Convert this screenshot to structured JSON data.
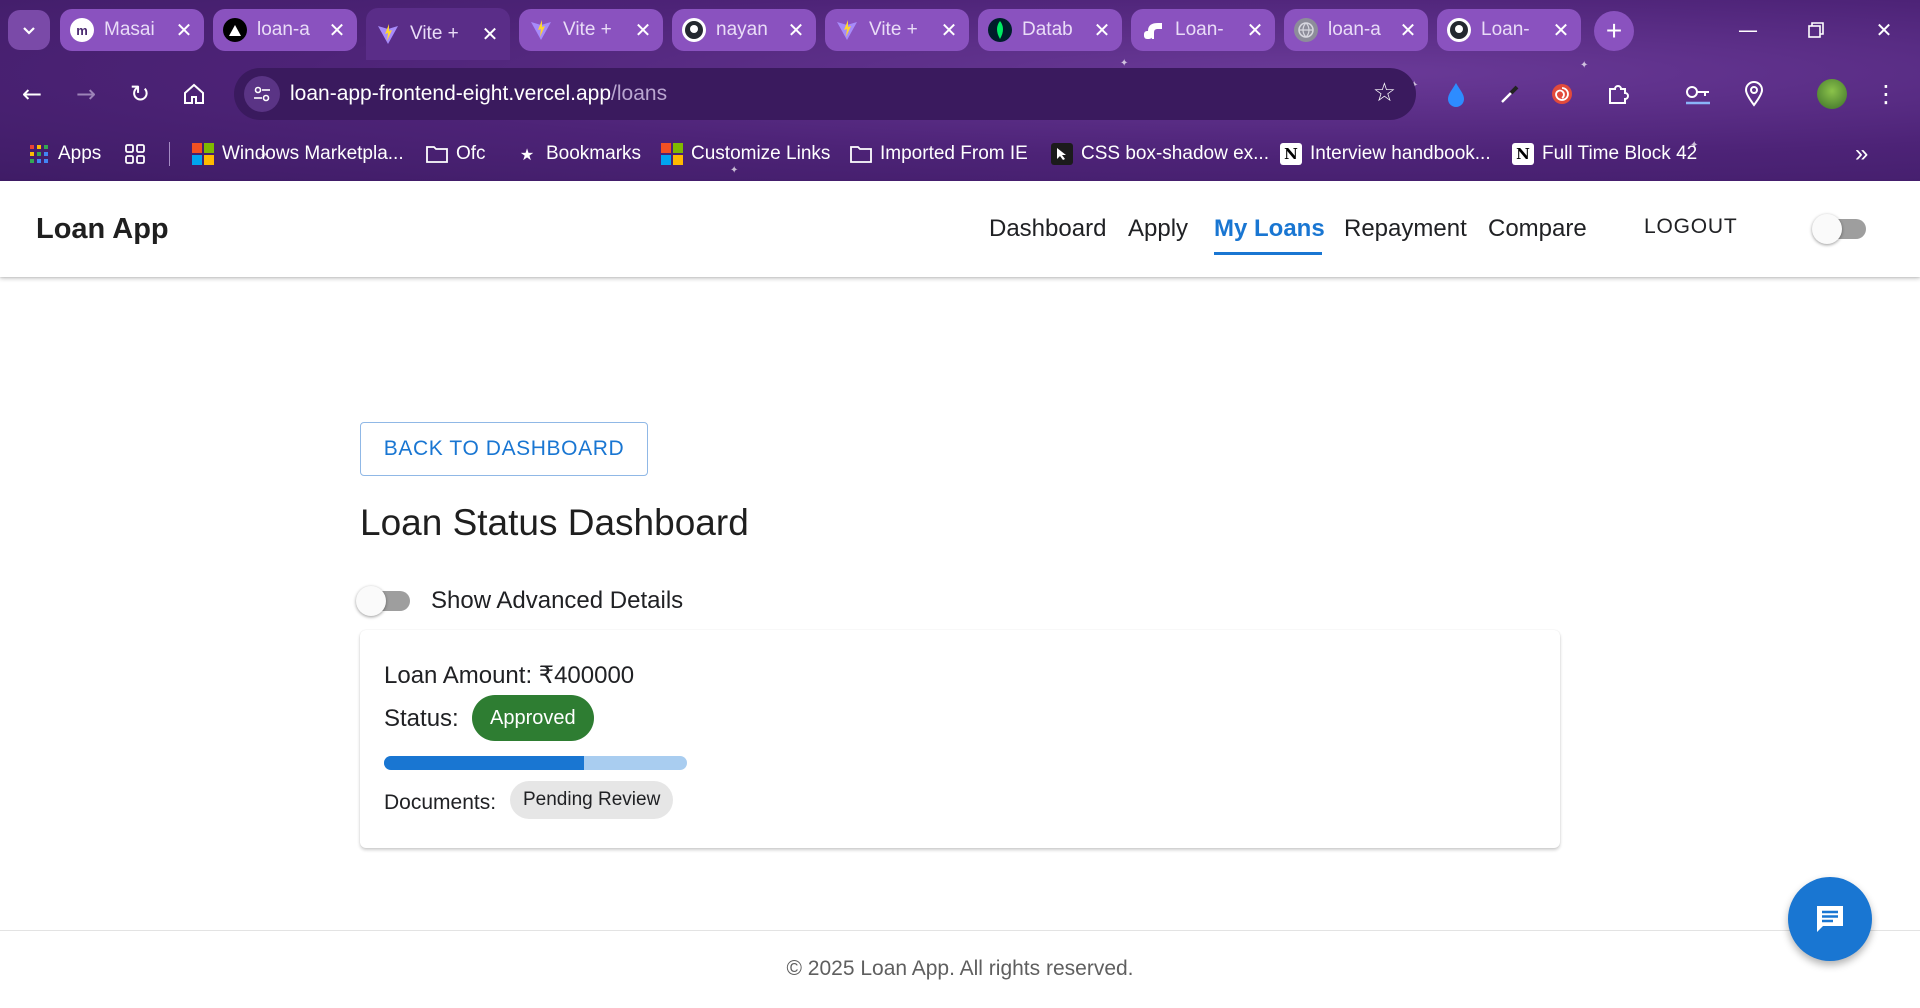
{
  "browser": {
    "tabs": [
      {
        "title": "Masai",
        "icon": "masai-logo-icon",
        "active": false
      },
      {
        "title": "loan-a",
        "icon": "vercel-logo-icon",
        "active": false
      },
      {
        "title": "Vite +",
        "icon": "vite-logo-icon",
        "active": true
      },
      {
        "title": "Vite +",
        "icon": "vite-logo-icon",
        "active": false
      },
      {
        "title": "nayan",
        "icon": "github-logo-icon",
        "active": false
      },
      {
        "title": "Vite +",
        "icon": "vite-logo-icon",
        "active": false
      },
      {
        "title": "Datab",
        "icon": "mongodb-leaf-icon",
        "active": false
      },
      {
        "title": "Loan-",
        "icon": "render-logo-icon",
        "active": false
      },
      {
        "title": "loan-a",
        "icon": "globe-icon",
        "active": false
      },
      {
        "title": "Loan-",
        "icon": "github-logo-icon",
        "active": false
      }
    ],
    "url_host": "loan-app-frontend-eight.vercel.app",
    "url_path": "/loans",
    "bookmarks": [
      {
        "label": "Apps",
        "icon": "apps-grid-icon"
      },
      {
        "label": "",
        "icon": "tab-groups-icon"
      },
      {
        "label": "Windows Marketpla...",
        "icon": "microsoft-logo-icon"
      },
      {
        "label": "Ofc",
        "icon": "folder-icon"
      },
      {
        "label": "Bookmarks",
        "icon": "star-icon"
      },
      {
        "label": "Customize Links",
        "icon": "microsoft-logo-icon"
      },
      {
        "label": "Imported From IE",
        "icon": "folder-icon"
      },
      {
        "label": "CSS box-shadow ex...",
        "icon": "cursor-icon"
      },
      {
        "label": "Interview handbook...",
        "icon": "notion-logo-icon"
      },
      {
        "label": "Full Time Block 42",
        "icon": "notion-logo-icon"
      }
    ]
  },
  "app": {
    "brand": "Loan App",
    "nav": [
      {
        "label": "Dashboard",
        "active": false
      },
      {
        "label": "Apply",
        "active": false
      },
      {
        "label": "My Loans",
        "active": true
      },
      {
        "label": "Repayment",
        "active": false
      },
      {
        "label": "Compare",
        "active": false
      }
    ],
    "logout_label": "LOGOUT",
    "theme_toggle_on": false
  },
  "main": {
    "back_button": "BACK TO DASHBOARD",
    "title": "Loan Status Dashboard",
    "advanced_toggle_label": "Show Advanced Details",
    "advanced_toggle_on": false,
    "loan": {
      "amount_label": "Loan Amount:",
      "amount_value": "₹400000",
      "status_label": "Status:",
      "status_value": "Approved",
      "progress_percent": 66,
      "documents_label": "Documents:",
      "documents_value": "Pending Review"
    }
  },
  "footer": {
    "text": "© 2025 Loan App. All rights reserved."
  },
  "colors": {
    "primary": "#1976d2",
    "approved": "#2e7d32",
    "chrome_purple": "#4d2377"
  }
}
